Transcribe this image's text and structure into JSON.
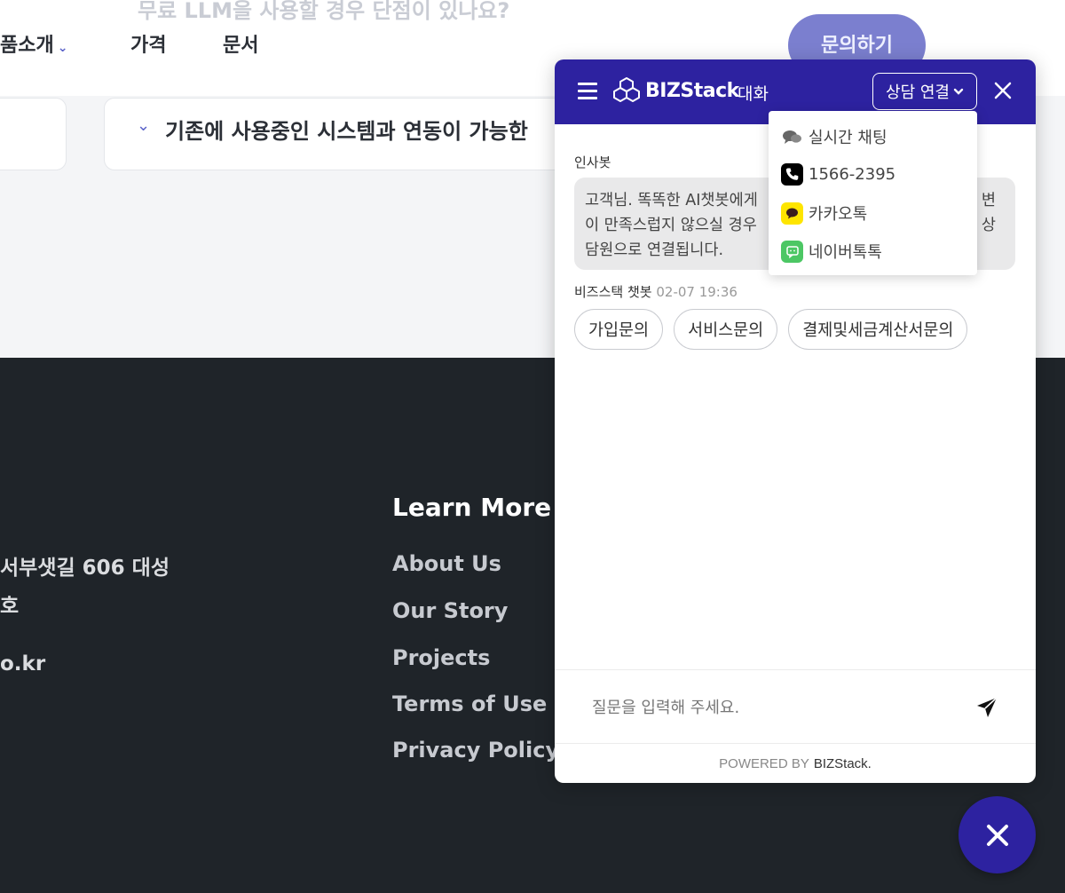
{
  "page": {
    "faq_peek": "무료 LLM을 사용할 경우 단점이 있나요?",
    "nav": [
      {
        "label": "품소개"
      },
      {
        "label": "가격"
      },
      {
        "label": "문서"
      }
    ],
    "inquiry_button": "문의하기",
    "faq_question": "기존에 사용중인 시스템과 연동이 가능한"
  },
  "footer": {
    "address_line1": "서부샛길 606 대성",
    "address_line2": "호",
    "email_fragment": "o.kr",
    "learn_more_heading": "Learn More",
    "links": [
      {
        "label": "About Us"
      },
      {
        "label": "Our Story"
      },
      {
        "label": "Projects"
      },
      {
        "label": "Terms of Use"
      },
      {
        "label": "Privacy Policy"
      }
    ]
  },
  "chat": {
    "brand": "BIZStack",
    "tab_title": "대화",
    "connect_button": "상담 연결",
    "connect_menu": [
      {
        "label": "실시간 채팅",
        "icon": "chat-bubbles-icon"
      },
      {
        "label": "1566-2395",
        "icon": "phone-icon"
      },
      {
        "label": "카카오톡",
        "icon": "kakaotalk-icon",
        "color": "#fee500"
      },
      {
        "label": "네이버톡톡",
        "icon": "naver-talktalk-icon",
        "color": "#4cc764"
      }
    ],
    "greeting_sender": "인사봇",
    "greeting_lines": [
      "고객님. 똑똑한 AI챗봇에게",
      "이 만족스럽지 않으실 경우",
      "담원으로 연결됩니다."
    ],
    "greeting_tail_right": [
      "변",
      "상"
    ],
    "bot_sender": "비즈스택 챗봇",
    "bot_time": "02-07 19:36",
    "quick_replies": [
      {
        "label": "가입문의"
      },
      {
        "label": "서비스문의"
      },
      {
        "label": "결제및세금계산서문의"
      }
    ],
    "input_placeholder": "질문을 입력해 주세요.",
    "powered_by": "POWERED BY",
    "powered_brand": "BIZStack."
  },
  "colors": {
    "header": "#2d22a0",
    "footer_bg": "#1f2429"
  }
}
